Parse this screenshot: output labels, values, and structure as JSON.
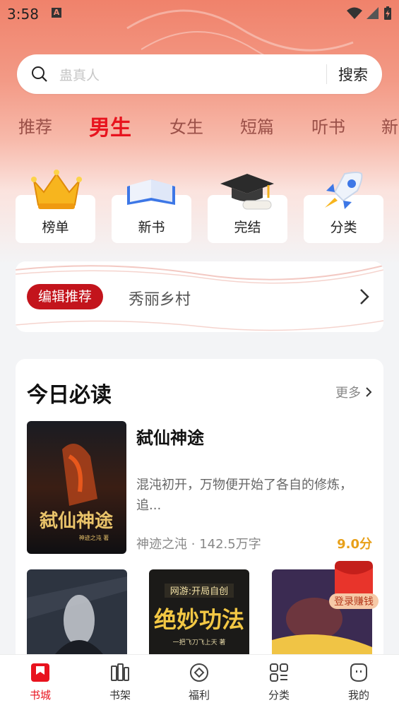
{
  "status_bar": {
    "time": "3:58"
  },
  "search": {
    "placeholder": "蛊真人",
    "button": "搜索"
  },
  "tabs": [
    "推荐",
    "男生",
    "女生",
    "短篇",
    "听书",
    "新"
  ],
  "active_tab": "男生",
  "quick_entries": [
    {
      "label": "榜单",
      "icon": "crown-icon"
    },
    {
      "label": "新书",
      "icon": "book-icon"
    },
    {
      "label": "完结",
      "icon": "graduation-cap-icon"
    },
    {
      "label": "分类",
      "icon": "rocket-icon"
    }
  ],
  "editor_pick": {
    "badge": "编辑推荐",
    "title": "秀丽乡村"
  },
  "today": {
    "heading": "今日必读",
    "more": "更多",
    "featured": {
      "title": "弑仙神途",
      "description": "混沌初开，万物便开始了各自的修炼，追...",
      "author": "神迹之沌",
      "separator": "·",
      "words": "142.5万字",
      "score": "9.0分",
      "cover_title": "弑仙神途",
      "cover_author": "神迹之沌 著"
    },
    "small_covers": [
      {
        "cover_title": ""
      },
      {
        "cover_title": "网游:开局自创",
        "cover_big": "绝妙功法",
        "cover_author": "一把飞刀飞上天 著"
      },
      {
        "cover_title": ""
      }
    ]
  },
  "red_packet": {
    "label": "登录赚钱"
  },
  "bottom_nav": [
    {
      "label": "书城",
      "icon": "bookstore-icon"
    },
    {
      "label": "书架",
      "icon": "bookshelf-icon"
    },
    {
      "label": "福利",
      "icon": "welfare-icon"
    },
    {
      "label": "分类",
      "icon": "category-icon"
    },
    {
      "label": "我的",
      "icon": "profile-icon"
    }
  ],
  "colors": {
    "accent": "#e8131e",
    "badge": "#c3141c",
    "score": "#e8a019",
    "tab_text": "#9a5048"
  }
}
